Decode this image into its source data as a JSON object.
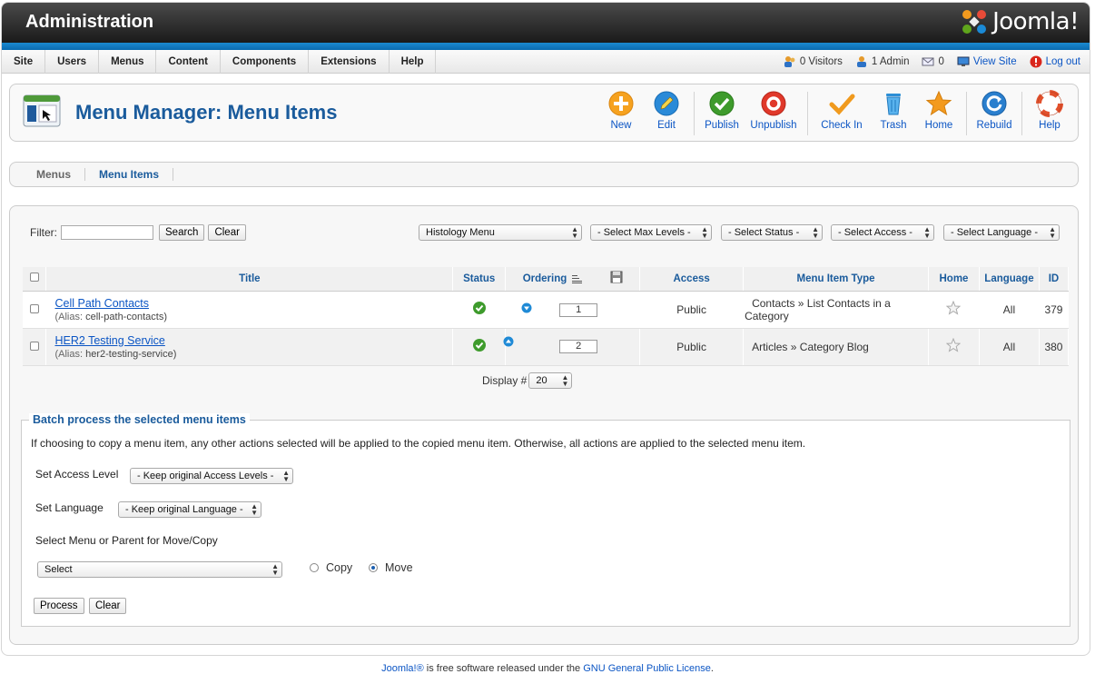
{
  "header": {
    "title": "Administration",
    "logo_text": "Joomla!"
  },
  "menubar": {
    "items": [
      {
        "label": "Site"
      },
      {
        "label": "Users"
      },
      {
        "label": "Menus"
      },
      {
        "label": "Content"
      },
      {
        "label": "Components"
      },
      {
        "label": "Extensions"
      },
      {
        "label": "Help"
      }
    ],
    "visitors": "0 Visitors",
    "admins": "1 Admin",
    "messages": "0",
    "view_site": "View Site",
    "logout": "Log out"
  },
  "toolbar": {
    "page_title": "Menu Manager: Menu Items",
    "buttons": {
      "new": "New",
      "edit": "Edit",
      "publish": "Publish",
      "unpublish": "Unpublish",
      "checkin": "Check In",
      "trash": "Trash",
      "home": "Home",
      "rebuild": "Rebuild",
      "help": "Help"
    }
  },
  "subtabs": [
    {
      "label": "Menus"
    },
    {
      "label": "Menu Items"
    }
  ],
  "filters": {
    "label": "Filter:",
    "search_value": "",
    "search_btn": "Search",
    "clear_btn": "Clear",
    "menu": "Histology Menu",
    "levels": "- Select Max Levels -",
    "status": "- Select Status -",
    "access": "- Select Access -",
    "language": "- Select Language -"
  },
  "table": {
    "headers": {
      "title": "Title",
      "status": "Status",
      "ordering": "Ordering",
      "access": "Access",
      "type": "Menu Item Type",
      "home": "Home",
      "language": "Language",
      "id": "ID"
    },
    "alias_label": "(Alias:",
    "rows": [
      {
        "title": "Cell Path Contacts",
        "alias": "cell-path-contacts)",
        "order": "1",
        "access": "Public",
        "type": "Contacts » List Contacts in a Category",
        "language": "All",
        "id": "379"
      },
      {
        "title": "HER2 Testing Service",
        "alias": "her2-testing-service)",
        "order": "2",
        "access": "Public",
        "type": "Articles » Category Blog",
        "language": "All",
        "id": "380"
      }
    ],
    "display_label": "Display #",
    "display_value": "20"
  },
  "batch": {
    "legend": "Batch process the selected menu items",
    "description": "If choosing to copy a menu item, any other actions selected will be applied to the copied menu item. Otherwise, all actions are applied to the selected menu item.",
    "access_label": "Set Access Level",
    "access_value": "- Keep original Access Levels -",
    "language_label": "Set Language",
    "language_value": "- Keep original Language -",
    "move_label": "Select Menu or Parent for Move/Copy",
    "move_value": "Select",
    "copy_label": "Copy",
    "move_radio_label": "Move",
    "process_btn": "Process",
    "clear_btn": "Clear"
  },
  "footer": {
    "brand": "Joomla!®",
    "text": " is free software released under the ",
    "license": "GNU General Public License",
    "end": "."
  },
  "colors": {
    "accent": "#1a5b9c",
    "link": "#0b55c4",
    "header_dark": "#1a1a1a",
    "strip_blue": "#1b8ad0"
  }
}
